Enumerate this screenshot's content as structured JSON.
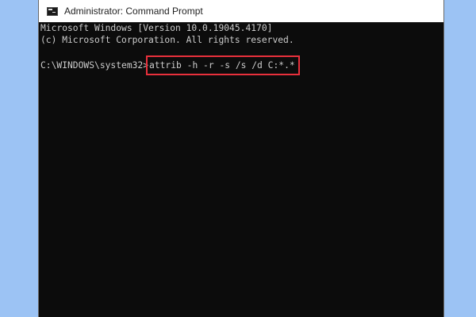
{
  "window": {
    "title": "Administrator: Command Prompt",
    "icon": "cmd-icon"
  },
  "console": {
    "lines": [
      "Microsoft Windows [Version 10.0.19045.4170]",
      "(c) Microsoft Corporation. All rights reserved."
    ],
    "prompt": "C:\\WINDOWS\\system32>",
    "command": "attrib -h -r -s /s /d C:*.*"
  },
  "colors": {
    "background": "#9cc3f4",
    "console_bg": "#0c0c0c",
    "console_text": "#cccccc",
    "highlight": "#e8303c"
  }
}
